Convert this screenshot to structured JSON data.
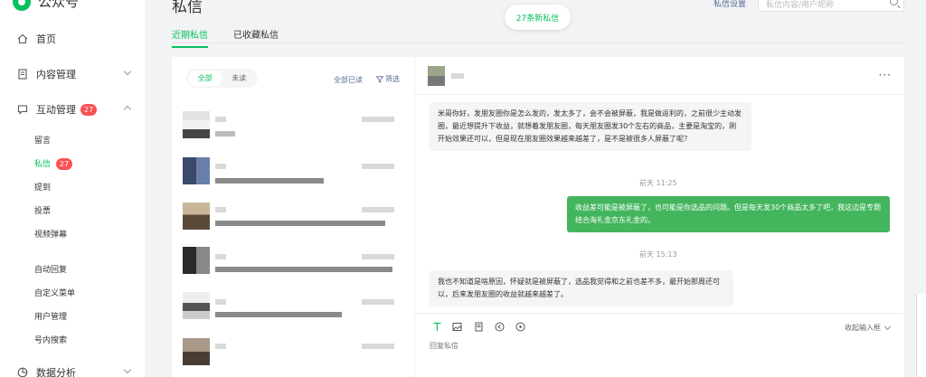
{
  "brand": {
    "name": "公众号"
  },
  "sidebar": {
    "items": [
      {
        "label": "首页",
        "icon": "home-icon"
      },
      {
        "label": "内容管理",
        "icon": "document-icon"
      },
      {
        "label": "互动管理",
        "icon": "chat-icon",
        "badge": "27"
      },
      {
        "label": "数据分析",
        "icon": "pie-chart-icon"
      }
    ],
    "sub_items": [
      {
        "label": "留言"
      },
      {
        "label": "私信",
        "badge": "27",
        "active": true
      },
      {
        "label": "提到"
      },
      {
        "label": "投票"
      },
      {
        "label": "视频弹幕"
      },
      {
        "label": "自动回复"
      },
      {
        "label": "自定义菜单"
      },
      {
        "label": "用户管理"
      },
      {
        "label": "号内搜索"
      }
    ]
  },
  "header": {
    "title": "私信",
    "settings_link": "私信设置",
    "search_placeholder": "私信内容/用户昵称",
    "new_messages": "27条新私信"
  },
  "tabs": [
    {
      "label": "近期私信",
      "active": true
    },
    {
      "label": "已收藏私信",
      "active": false
    }
  ],
  "list": {
    "filter_all": "全部",
    "filter_unread": "未读",
    "mark_all_read": "全部已读",
    "filter_label": "筛选"
  },
  "chat": {
    "messages": [
      {
        "direction": "in",
        "text": "米哥你好，发朋友圈你是怎么发的，发太多了，会不会被屏蔽，我是做返利的，之前很少主动发圈，最近想提升下收益，就想着发朋友圈，每天朋友圈发30个左右的商品，主要是淘宝的，刚开始效果还可以，但是现在朋友圈效果越来越差了，是不是被很多人屏蔽了呢？"
      },
      {
        "timestamp": "前天 11:25"
      },
      {
        "direction": "out",
        "text": "收益差可能是被屏蔽了，也可能是你选品的问题。但是每天发30个商品太多了吧，我这边是专题结合淘礼金京东礼金的。"
      },
      {
        "timestamp": "前天 15:13"
      },
      {
        "direction": "in",
        "text": "我也不知道是啥原因，怀疑就是被屏蔽了，选品我觉得和之前也差不多，最开始那周还可以，后来发朋友圈的收益就越来越差了。"
      }
    ],
    "collapse_label": "收起输入框",
    "reply_placeholder": "回复私信"
  },
  "colors": {
    "accent": "#07c160",
    "badge": "#fa5151",
    "link": "#576b95",
    "out_bubble": "#43b55d"
  }
}
